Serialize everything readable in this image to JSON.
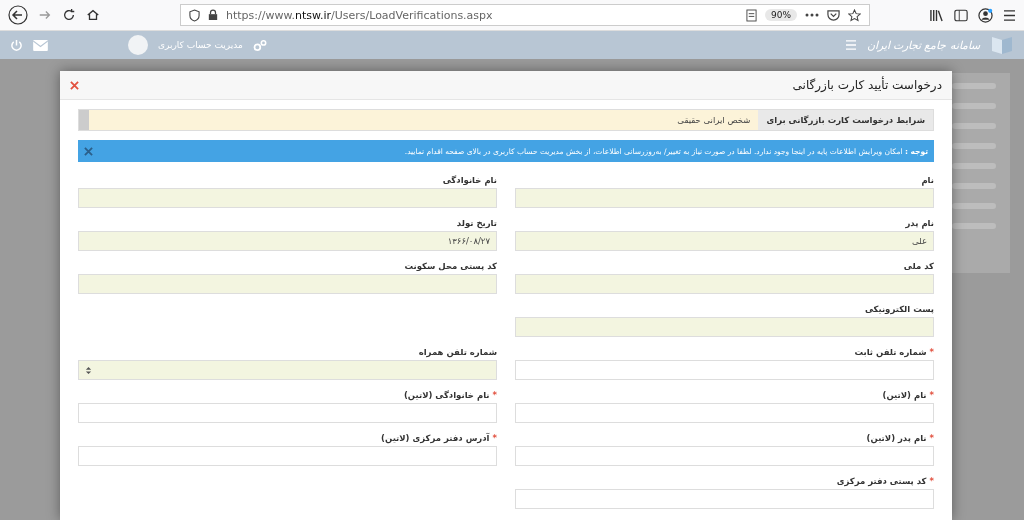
{
  "browser": {
    "url_prefix": "https://www.",
    "url_domain": "ntsw.ir",
    "url_path": "/Users/LoadVerifications.aspx",
    "zoom": "90%"
  },
  "app_bar": {
    "logo_text": "سامانه جامع تجارت ایران",
    "account_link": "مدیریت حساب کاربری"
  },
  "dialog": {
    "title": "درخواست تأیید کارت بازرگانی",
    "condition": {
      "label": "شرایط درخواست کارت بازرگانی برای",
      "value": "شخص ایرانی حقیقی"
    },
    "notice": "**توجه :** امکان ویرایش اطلاعات پایه در اینجا وجود ندارد. لطفا در صورت نیاز به تغییر/ بەروزرسانی اطلاعات، از بخش مدیریت حساب کاربری در بالای صفحه اقدام نمایید.",
    "rows": [
      {
        "fields": [
          {
            "label": "نام",
            "readonly": true,
            "kind": "text"
          },
          {
            "label": "نام خانوادگی",
            "readonly": true,
            "kind": "text"
          }
        ]
      },
      {
        "fields": [
          {
            "label": "نام پدر",
            "readonly": true,
            "kind": "text",
            "value": "علی"
          },
          {
            "label": "تاریخ تولد",
            "readonly": true,
            "kind": "text",
            "value": "۱۳۶۶/۰۸/۲۷"
          }
        ]
      },
      {
        "fields": [
          {
            "label": "کد ملی",
            "readonly": true,
            "kind": "text"
          },
          {
            "label": "کد پستی محل سکونت",
            "readonly": true,
            "kind": "text"
          }
        ]
      },
      {
        "fields": [
          {
            "label": "پست الکترونیکی",
            "readonly": true,
            "kind": "text"
          }
        ]
      },
      {
        "fields": [
          {
            "label": "شماره تلفن ثابت",
            "required_mark": "*",
            "readonly": false,
            "kind": "text"
          },
          {
            "label": "شماره تلفن همراه",
            "readonly": true,
            "kind": "number"
          }
        ]
      },
      {
        "fields": [
          {
            "label": "نام (لاتین)",
            "required_mark": "*",
            "readonly": false,
            "kind": "text"
          },
          {
            "label": "نام خانوادگی (لاتین)",
            "required_mark": "*",
            "readonly": false,
            "kind": "text"
          }
        ]
      },
      {
        "fields": [
          {
            "label": "نام پدر (لاتین)",
            "required_mark": "*",
            "readonly": false,
            "kind": "text"
          },
          {
            "label": "آدرس دفتر مرکزی (لاتین)",
            "required_mark": "*",
            "readonly": false,
            "kind": "text"
          }
        ]
      },
      {
        "fields": [
          {
            "label": "کد پستی دفتر مرکزی",
            "required_mark": "*",
            "readonly": false,
            "kind": "text"
          }
        ]
      }
    ]
  }
}
